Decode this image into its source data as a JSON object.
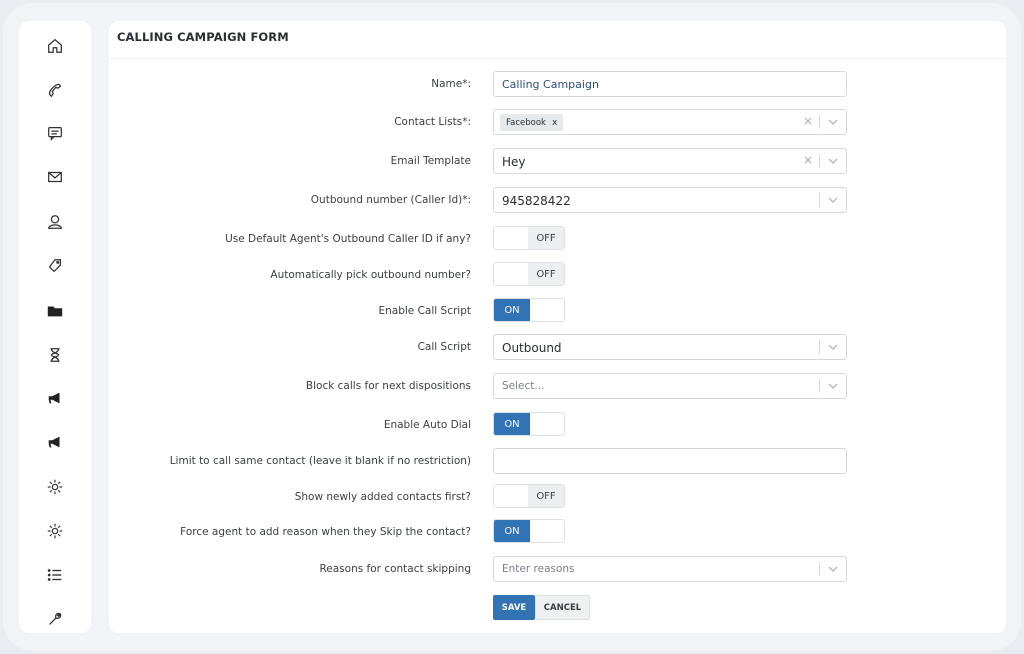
{
  "panel": {
    "title": "CALLING CAMPAIGN FORM"
  },
  "sidebar": {
    "items": [
      {
        "icon": "home-icon"
      },
      {
        "icon": "phone-icon"
      },
      {
        "icon": "chat-icon"
      },
      {
        "icon": "mail-icon"
      },
      {
        "icon": "user-icon"
      },
      {
        "icon": "tag-icon"
      },
      {
        "icon": "folder-icon"
      },
      {
        "icon": "hourglass-icon"
      },
      {
        "icon": "megaphone-icon"
      },
      {
        "icon": "megaphone-icon"
      },
      {
        "icon": "gear-icon"
      },
      {
        "icon": "gear-icon"
      },
      {
        "icon": "list-icon"
      },
      {
        "icon": "wrench-icon"
      }
    ]
  },
  "form": {
    "name": {
      "label": "Name*:",
      "value": "Calling Campaign"
    },
    "contact_lists": {
      "label": "Contact Lists*:",
      "tag": "Facebook",
      "tag_remove": "x",
      "clear": "×"
    },
    "email_template": {
      "label": "Email Template",
      "value": "Hey",
      "clear": "×"
    },
    "outbound_number": {
      "label": "Outbound number (Caller Id)*:",
      "value": "945828422"
    },
    "default_caller_id": {
      "label": "Use Default Agent's Outbound Caller ID if any?",
      "state": "OFF"
    },
    "auto_pick": {
      "label": "Automatically pick outbound number?",
      "state": "OFF"
    },
    "enable_call_script": {
      "label": "Enable Call Script",
      "state": "ON"
    },
    "call_script": {
      "label": "Call Script",
      "value": "Outbound"
    },
    "block_calls": {
      "label": "Block calls for next dispositions",
      "placeholder": "Select..."
    },
    "enable_auto_dial": {
      "label": "Enable Auto Dial",
      "state": "ON"
    },
    "limit_same_contact": {
      "label": "Limit to call same contact (leave it blank if no restriction)",
      "value": ""
    },
    "newly_added_first": {
      "label": "Show newly added contacts first?",
      "state": "OFF"
    },
    "force_reason": {
      "label": "Force agent to add reason when they Skip the contact?",
      "state": "ON"
    },
    "skip_reasons": {
      "label": "Reasons for contact skipping",
      "placeholder": "Enter reasons"
    },
    "buttons": {
      "save": "SAVE",
      "cancel": "CANCEL"
    }
  },
  "colors": {
    "accent": "#3173b5",
    "background": "#f1f3f6"
  }
}
